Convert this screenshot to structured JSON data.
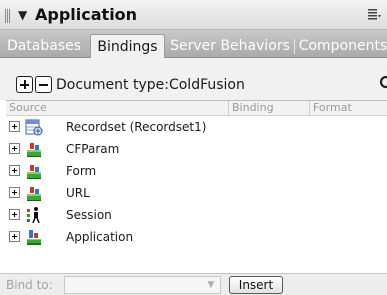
{
  "panel": {
    "title": "Application"
  },
  "tabs": [
    {
      "label": "Databases",
      "active": false
    },
    {
      "label": "Bindings",
      "active": true
    },
    {
      "label": "Server Behaviors",
      "active": false
    },
    {
      "label": "Components",
      "active": false
    }
  ],
  "toolbar": {
    "add_icon": "plus-icon",
    "remove_icon": "minus-icon",
    "document_type": "Document type:ColdFusion",
    "refresh_icon": "refresh-icon"
  },
  "columns": {
    "source": "Source",
    "binding": "Binding",
    "format": "Format"
  },
  "bindings_tree": [
    {
      "label": "Recordset (Recordset1)",
      "icon": "recordset-icon"
    },
    {
      "label": "CFParam",
      "icon": "cfparam-icon"
    },
    {
      "label": "Form",
      "icon": "form-icon"
    },
    {
      "label": "URL",
      "icon": "url-icon"
    },
    {
      "label": "Session",
      "icon": "session-icon"
    },
    {
      "label": "Application",
      "icon": "application-icon"
    }
  ],
  "footer": {
    "bind_to_label": "Bind to:",
    "bind_to_value": "",
    "insert_label": "Insert"
  }
}
